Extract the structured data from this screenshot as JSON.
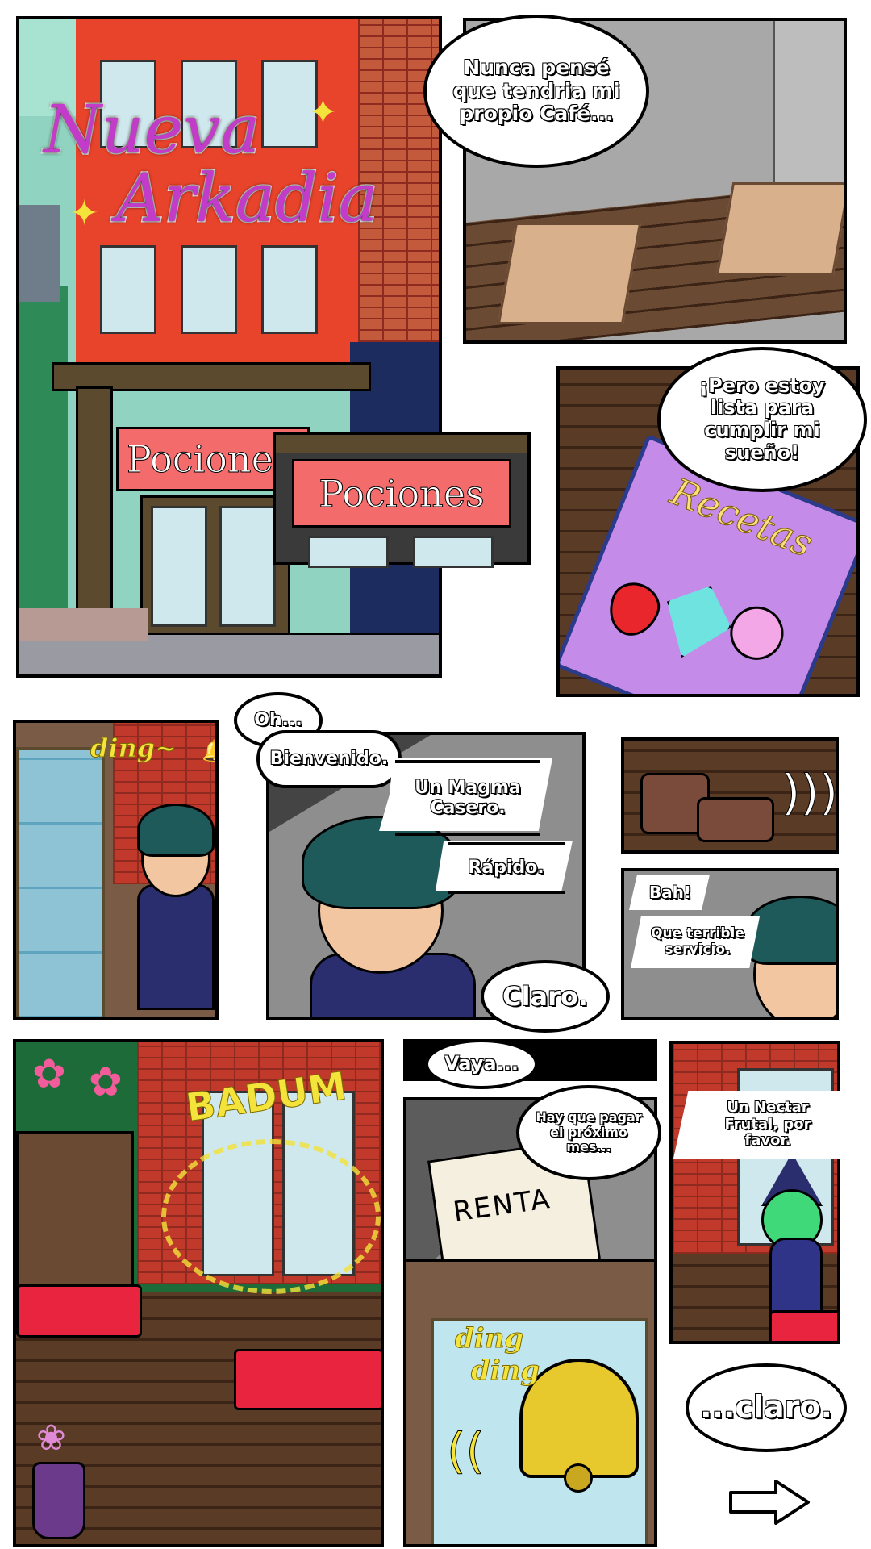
{
  "panel1": {
    "title_line1": "Nueva",
    "title_line2": "Arkadia",
    "sign_back": "Pociones",
    "sign_front": "Pociones"
  },
  "panel2": {
    "bubble": "Nunca pensé que tendria mi propio Café..."
  },
  "panel3": {
    "bubble": "¡Pero estoy lista para cumplir mi sueño!",
    "book_title": "Recetas"
  },
  "panel4": {
    "sfx": "ding~"
  },
  "panel5": {
    "bubble_oh": "Oh...",
    "bubble_welcome": "Bienvenido.",
    "bubble_order": "Un Magma Casero.",
    "bubble_fast": "Rápido.",
    "bubble_sure": "Claro."
  },
  "panel7": {
    "bubble_bah": "Bah!",
    "bubble_service": "Que terrible servicio."
  },
  "panel8": {
    "sfx": "BADUM"
  },
  "panel9": {
    "bubble_vaya": "Vaya...",
    "bubble_pay": "Hay que pagar el próximo mes...",
    "paper": "RENTA"
  },
  "panel10": {
    "sfx_line1": "ding",
    "sfx_line2": "ding"
  },
  "panel11": {
    "bubble": "Un Nectar Frutal, por favor."
  },
  "final": {
    "bubble": "...claro."
  },
  "icons": {
    "next": "right-arrow-icon"
  },
  "colors": {
    "title_magenta": "#c23bc9",
    "sign_red": "#f36b6b",
    "sfx_yellow": "#f4e33a",
    "hair_teal": "#1f5a5a"
  }
}
